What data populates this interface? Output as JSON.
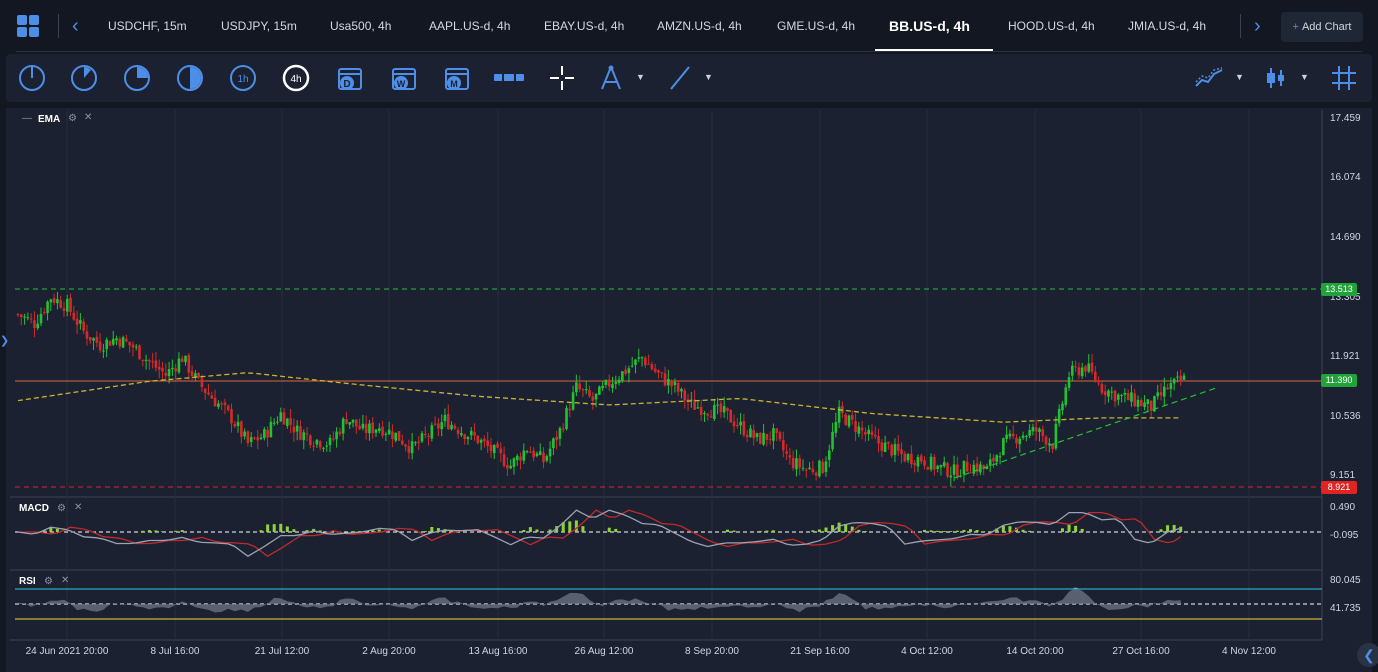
{
  "tabs": [
    {
      "label": "USDCHF, 15m",
      "active": false
    },
    {
      "label": "USDJPY, 15m",
      "active": false
    },
    {
      "label": "Usa500, 4h",
      "active": false
    },
    {
      "label": "AAPL.US-d, 4h",
      "active": false
    },
    {
      "label": "EBAY.US-d, 4h",
      "active": false
    },
    {
      "label": "AMZN.US-d, 4h",
      "active": false
    },
    {
      "label": "GME.US-d, 4h",
      "active": false
    },
    {
      "label": "BB.US-d, 4h",
      "active": true
    },
    {
      "label": "HOOD.US-d, 4h",
      "active": false
    },
    {
      "label": "JMIA.US-d, 4h",
      "active": false
    }
  ],
  "add_chart_label": "Add Chart",
  "toolbar": {
    "timeframe_icons": [
      "1m-clock-icon",
      "5m-clock-icon",
      "15m-clock-icon",
      "30m-clock-icon",
      "1h-clock-icon",
      "4h-clock-icon"
    ],
    "timeframe_labels": {
      "h1": "1h",
      "h4": "4h"
    },
    "calendar_icons": [
      {
        "name": "daily-calendar-icon",
        "letter": "D"
      },
      {
        "name": "weekly-calendar-icon",
        "letter": "W"
      },
      {
        "name": "monthly-calendar-icon",
        "letter": "M"
      }
    ]
  },
  "indicators": {
    "main": "EMA",
    "macd": "MACD",
    "rsi": "RSI"
  },
  "price_axis": [
    "17.459",
    "16.074",
    "14.690",
    "13.305",
    "11.921",
    "10.536",
    "9.151"
  ],
  "price_badges": {
    "resistance": {
      "value": "13.513",
      "color": "#22a33a"
    },
    "current": {
      "value": "11.390",
      "color": "#22a33a"
    },
    "support": {
      "value": "8.921",
      "color": "#e02424"
    }
  },
  "macd_axis": [
    "0.490",
    "-0.095"
  ],
  "rsi_axis": [
    "80.045",
    "41.735"
  ],
  "date_axis": [
    "24 Jun 2021 20:00",
    "8 Jul 16:00",
    "21 Jul 12:00",
    "2 Aug 20:00",
    "13 Aug 16:00",
    "26 Aug 12:00",
    "8 Sep 20:00",
    "21 Sep 16:00",
    "4 Oct 12:00",
    "14 Oct 20:00",
    "27 Oct 16:00",
    "4 Nov 12:00"
  ],
  "colors": {
    "accent": "#4d8ee6",
    "up": "#22c232",
    "down": "#d42a2a",
    "ema": "#c8b432",
    "background": "#1b2130"
  },
  "chart_data": {
    "type": "candlestick",
    "title": "BB.US-d, 4h",
    "ylim": [
      8.6,
      17.5
    ],
    "resistance_level": 13.513,
    "support_level": 8.921,
    "current_price": 11.39,
    "close_path": [
      [
        0,
        12.9
      ],
      [
        5,
        12.7
      ],
      [
        10,
        13.3
      ],
      [
        15,
        13.1
      ],
      [
        20,
        12.5
      ],
      [
        25,
        12.2
      ],
      [
        30,
        12.35
      ],
      [
        35,
        12.15
      ],
      [
        40,
        11.8
      ],
      [
        45,
        11.5
      ],
      [
        50,
        11.9
      ],
      [
        55,
        11.3
      ],
      [
        60,
        10.9
      ],
      [
        65,
        10.5
      ],
      [
        70,
        9.9
      ],
      [
        75,
        10.1
      ],
      [
        80,
        10.6
      ],
      [
        85,
        10.2
      ],
      [
        90,
        10.0
      ],
      [
        95,
        9.9
      ],
      [
        100,
        10.5
      ],
      [
        105,
        10.2
      ],
      [
        110,
        10.3
      ],
      [
        115,
        10.1
      ],
      [
        120,
        9.8
      ],
      [
        125,
        10.1
      ],
      [
        130,
        10.45
      ],
      [
        135,
        10.2
      ],
      [
        140,
        10.0
      ],
      [
        145,
        9.7
      ],
      [
        150,
        9.4
      ],
      [
        155,
        9.8
      ],
      [
        160,
        9.5
      ],
      [
        165,
        10.2
      ],
      [
        170,
        11.2
      ],
      [
        175,
        10.9
      ],
      [
        180,
        11.3
      ],
      [
        185,
        11.6
      ],
      [
        190,
        11.9
      ],
      [
        195,
        11.5
      ],
      [
        200,
        11.2
      ],
      [
        205,
        10.8
      ],
      [
        210,
        10.7
      ],
      [
        215,
        10.6
      ],
      [
        220,
        10.3
      ],
      [
        225,
        10.0
      ],
      [
        230,
        10.1
      ],
      [
        235,
        9.5
      ],
      [
        240,
        9.3
      ],
      [
        245,
        9.35
      ],
      [
        250,
        10.6
      ],
      [
        255,
        10.3
      ],
      [
        260,
        10.0
      ],
      [
        265,
        9.8
      ],
      [
        270,
        9.6
      ],
      [
        275,
        9.55
      ],
      [
        280,
        9.35
      ],
      [
        285,
        9.25
      ],
      [
        290,
        9.4
      ],
      [
        295,
        9.3
      ],
      [
        300,
        9.9
      ],
      [
        305,
        10.1
      ],
      [
        310,
        10.2
      ],
      [
        315,
        9.9
      ],
      [
        320,
        11.5
      ],
      [
        325,
        11.7
      ],
      [
        330,
        11.2
      ],
      [
        335,
        11.0
      ],
      [
        340,
        10.9
      ],
      [
        345,
        10.75
      ],
      [
        350,
        11.2
      ],
      [
        355,
        11.39
      ]
    ],
    "ema_path": [
      [
        0,
        10.9
      ],
      [
        40,
        11.35
      ],
      [
        70,
        11.55
      ],
      [
        100,
        11.3
      ],
      [
        140,
        11.0
      ],
      [
        180,
        10.8
      ],
      [
        220,
        10.95
      ],
      [
        260,
        10.6
      ],
      [
        300,
        10.4
      ],
      [
        330,
        10.5
      ],
      [
        355,
        10.5
      ]
    ],
    "trendline": {
      "from": [
        285,
        9.1
      ],
      "to": [
        365,
        11.2
      ]
    }
  }
}
